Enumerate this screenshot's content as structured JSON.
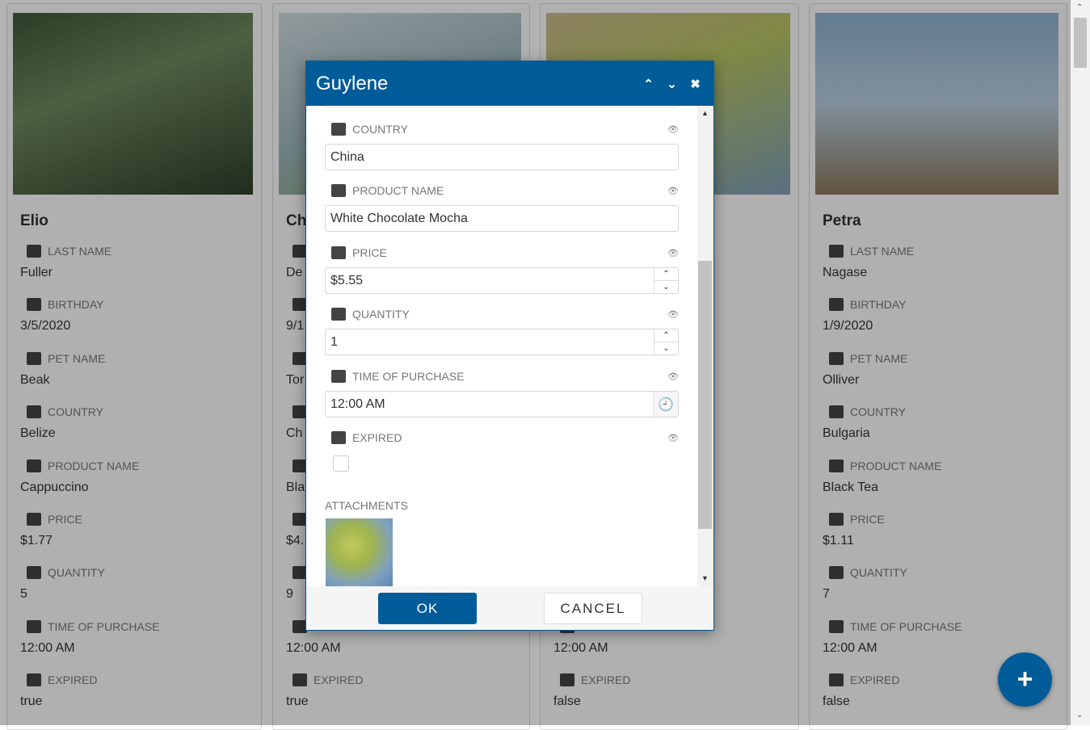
{
  "colors": {
    "accent": "#005b99",
    "overlay": "rgba(0,0,0,0.3)"
  },
  "field_labels": [
    "LAST NAME",
    "BIRTHDAY",
    "PET NAME",
    "COUNTRY",
    "PRODUCT NAME",
    "PRICE",
    "QUANTITY",
    "TIME OF PURCHASE",
    "EXPIRED"
  ],
  "field_icons": [
    "signature-icon",
    "birthday-cake-icon",
    "cat-icon",
    "globe-icon",
    "archive-box-icon",
    "tag-icon",
    "quantity-chart-icon",
    "alarm-clock-icon",
    "expired-icon"
  ],
  "cards": [
    {
      "name": "Elio",
      "values": [
        "Fuller",
        "3/5/2020",
        "Beak",
        "Belize",
        "Cappuccino",
        "$1.77",
        "5",
        "12:00 AM",
        "true"
      ]
    },
    {
      "name": "Ch",
      "values": [
        "De",
        "9/1",
        "Tor",
        "Ch",
        "Bla",
        "$4.",
        "9",
        "12:00 AM",
        "true"
      ]
    },
    {
      "name": "",
      "values": [
        "",
        "",
        "",
        "",
        "",
        "",
        "",
        "12:00 AM",
        "false"
      ]
    },
    {
      "name": "Petra",
      "values": [
        "Nagase",
        "1/9/2020",
        "Olliver",
        "Bulgaria",
        "Black Tea",
        "$1.11",
        "7",
        "12:00 AM",
        "false"
      ]
    }
  ],
  "dialog": {
    "title": "Guylene",
    "fields": [
      {
        "label": "COUNTRY",
        "icon": "globe-icon",
        "value": "China",
        "type": "text"
      },
      {
        "label": "PRODUCT NAME",
        "icon": "archive-box-icon",
        "value": "White Chocolate Mocha",
        "type": "text"
      },
      {
        "label": "PRICE",
        "icon": "tag-icon",
        "value": "$5.55",
        "type": "number"
      },
      {
        "label": "QUANTITY",
        "icon": "quantity-chart-icon",
        "value": "1",
        "type": "number"
      },
      {
        "label": "TIME OF PURCHASE",
        "icon": "alarm-clock-icon",
        "value": "12:00 AM",
        "type": "time"
      },
      {
        "label": "EXPIRED",
        "icon": "expired-icon",
        "value": false,
        "type": "checkbox"
      }
    ],
    "attachments_label": "ATTACHMENTS",
    "ok_label": "OK",
    "cancel_label": "CANCEL"
  },
  "fab_label": "+"
}
